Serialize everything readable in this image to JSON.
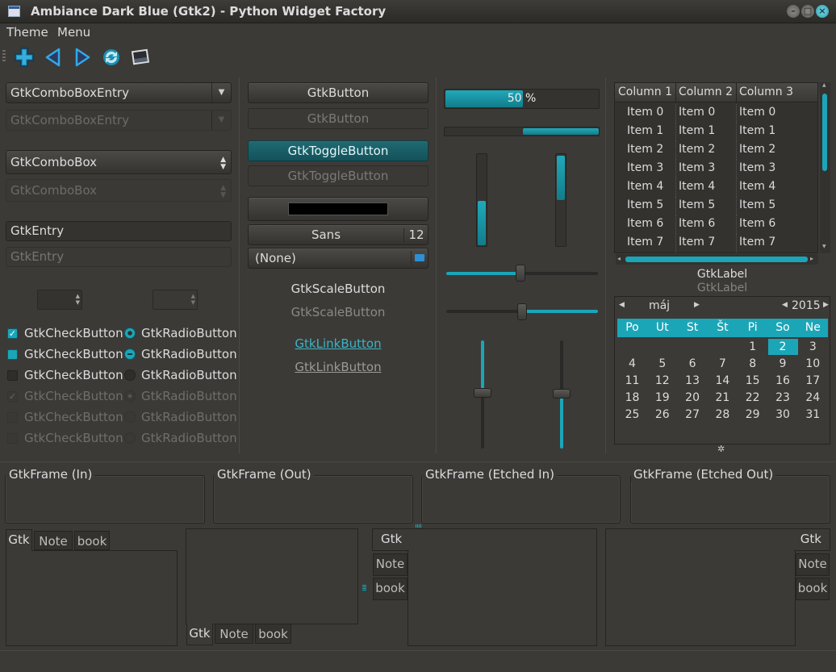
{
  "window": {
    "title": "Ambiance Dark Blue (Gtk2) - Python Widget Factory"
  },
  "menu": [
    "Theme",
    "Menu"
  ],
  "toolbar": [
    "add-icon",
    "back-icon",
    "forward-icon",
    "refresh-icon",
    "picture-icon"
  ],
  "combos": {
    "combo_entry": "GtkComboBoxEntry",
    "combo_entry_dis": "GtkComboBoxEntry",
    "combo": "GtkComboBox",
    "combo_dis": "GtkComboBox"
  },
  "entries": {
    "entry": "GtkEntry",
    "entry_dis": "GtkEntry"
  },
  "checks": {
    "check_label": "GtkCheckButton",
    "radio_label": "GtkRadioButton"
  },
  "buttons": {
    "button": "GtkButton",
    "button_dis": "GtkButton",
    "toggle": "GtkToggleButton",
    "toggle_dis": "GtkToggleButton",
    "font_name": "Sans",
    "font_size": "12",
    "file_chooser": "(None)",
    "scale_button": "GtkScaleButton",
    "scale_button_dis": "GtkScaleButton",
    "link": "GtkLinkButton",
    "link_dis": "GtkLinkButton"
  },
  "progress": {
    "text": "50 %",
    "value": 0.5
  },
  "tree": {
    "columns": [
      "Column 1",
      "Column 2",
      "Column 3"
    ],
    "rows": [
      [
        "Item 0",
        "Item 0",
        "Item 0"
      ],
      [
        "Item 1",
        "Item 1",
        "Item 1"
      ],
      [
        "Item 2",
        "Item 2",
        "Item 2"
      ],
      [
        "Item 3",
        "Item 3",
        "Item 3"
      ],
      [
        "Item 4",
        "Item 4",
        "Item 4"
      ],
      [
        "Item 5",
        "Item 5",
        "Item 5"
      ],
      [
        "Item 6",
        "Item 6",
        "Item 6"
      ],
      [
        "Item 7",
        "Item 7",
        "Item 7"
      ]
    ]
  },
  "labels": {
    "label": "GtkLabel",
    "label_dis": "GtkLabel"
  },
  "calendar": {
    "month": "máj",
    "year": "2015",
    "weekdays": [
      "Po",
      "Ut",
      "St",
      "Št",
      "Pi",
      "So",
      "Ne"
    ],
    "weeks": [
      [
        "",
        "",
        "",
        "",
        "1",
        "2",
        "3"
      ],
      [
        "4",
        "5",
        "6",
        "7",
        "8",
        "9",
        "10"
      ],
      [
        "11",
        "12",
        "13",
        "14",
        "15",
        "16",
        "17"
      ],
      [
        "18",
        "19",
        "20",
        "21",
        "22",
        "23",
        "24"
      ],
      [
        "25",
        "26",
        "27",
        "28",
        "29",
        "30",
        "31"
      ]
    ],
    "selected": "2"
  },
  "frames": [
    "GtkFrame (In)",
    "GtkFrame (Out)",
    "GtkFrame (Etched In)",
    "GtkFrame (Etched Out)"
  ],
  "notebooks": {
    "tabs": [
      "Gtk",
      "Note",
      "book"
    ]
  },
  "colors": {
    "accent": "#1ba6b8",
    "background": "#3b3a37"
  }
}
